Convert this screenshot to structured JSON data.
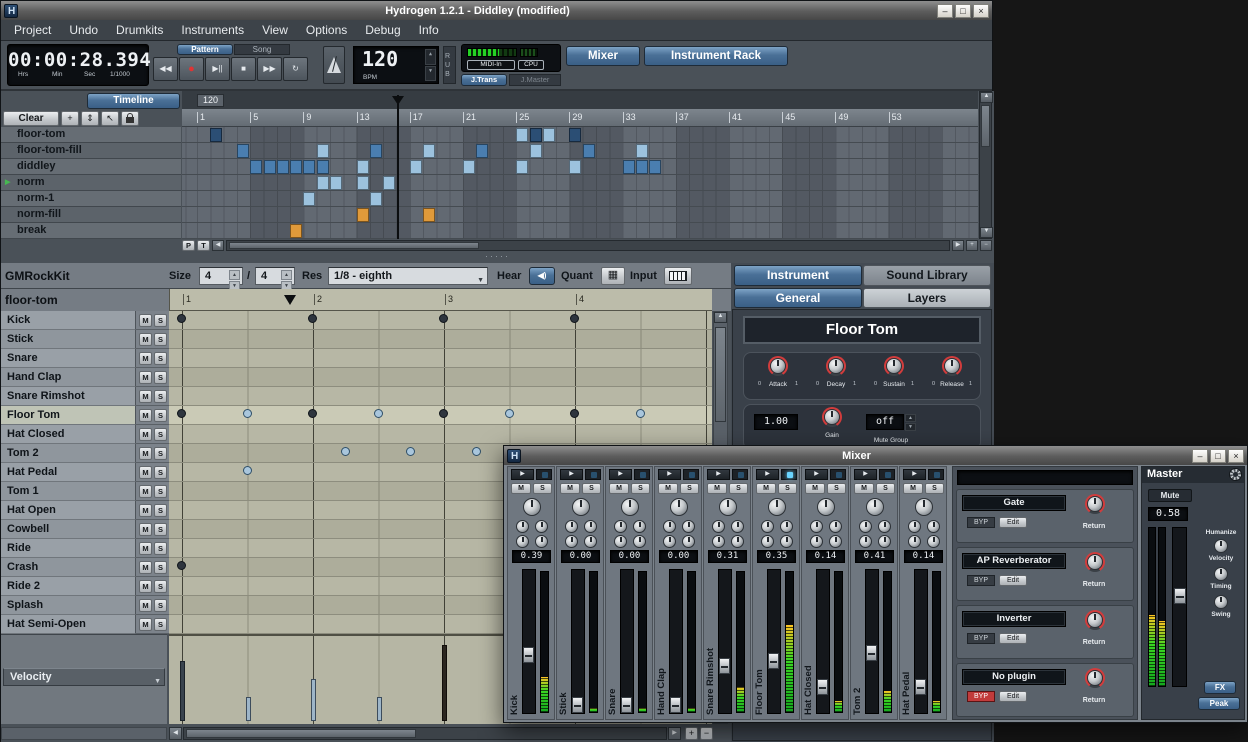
{
  "main_window": {
    "title": "Hydrogen 1.2.1 - Diddley (modified)"
  },
  "icons": {
    "minimize": "–",
    "maximize": "□",
    "close": "×",
    "rewind": "◀◀",
    "record": "●",
    "play_pause": "▶||",
    "stop": "■",
    "forward": "▶▶",
    "loop": "↻",
    "spin_up": "▲",
    "spin_down": "▼",
    "dropdown": "▼",
    "scroll_left": "◀",
    "scroll_right": "▶",
    "scroll_up": "▲",
    "scroll_down": "▼",
    "plus": "+",
    "minus": "−",
    "updown": "⇕",
    "select": "↖",
    "speaker": "◀)",
    "grid": "▦",
    "play_small": "▶"
  },
  "menu": {
    "items": [
      "Project",
      "Undo",
      "Drumkits",
      "Instruments",
      "View",
      "Options",
      "Debug",
      "Info"
    ]
  },
  "transport": {
    "time_value": "00:00:28.394",
    "time_units": [
      "Hrs",
      "Min",
      "Sec",
      "1/1000"
    ],
    "mode_pattern": "Pattern",
    "mode_song": "Song",
    "bpm_value": "120",
    "bpm_label": "BPM",
    "rubberband": "RUB",
    "midi_label": "MIDI-In",
    "cpu_label": "CPU",
    "jack_transport": "J.Trans",
    "jack_master": "J.Master",
    "mixer_button": "Mixer",
    "rack_button": "Instrument Rack"
  },
  "song_editor": {
    "timeline_button": "Timeline",
    "clear_button": "Clear",
    "tempo_tag": "120",
    "ruler_ticks": [
      1,
      5,
      9,
      13,
      17,
      21,
      25,
      29,
      33,
      37,
      41,
      45,
      49,
      53
    ],
    "playhead_col": 16,
    "patterns": [
      "floor-tom",
      "floor-tom-fill",
      "diddley",
      "norm",
      "norm-1",
      "norm-fill",
      "break"
    ],
    "playing_pattern_index": 3,
    "button_p": "P",
    "button_t": "T",
    "cell_colors": {
      "mid": "#4a7eb0",
      "light": "#9cc2de",
      "dark": "#2b4e74",
      "orange": "#e09a3a"
    },
    "cells": [
      {
        "row": 0,
        "col": 2,
        "color": "dark"
      },
      {
        "row": 0,
        "col": 25,
        "color": "light"
      },
      {
        "row": 0,
        "col": 26,
        "color": "dark"
      },
      {
        "row": 0,
        "col": 27,
        "color": "light"
      },
      {
        "row": 0,
        "col": 29,
        "color": "dark"
      },
      {
        "row": 1,
        "col": 4,
        "color": "mid"
      },
      {
        "row": 1,
        "col": 10,
        "color": "light"
      },
      {
        "row": 1,
        "col": 14,
        "color": "mid"
      },
      {
        "row": 1,
        "col": 18,
        "color": "light"
      },
      {
        "row": 1,
        "col": 22,
        "color": "mid"
      },
      {
        "row": 1,
        "col": 26,
        "color": "light"
      },
      {
        "row": 1,
        "col": 30,
        "color": "mid"
      },
      {
        "row": 1,
        "col": 34,
        "color": "light"
      },
      {
        "row": 2,
        "col": 5,
        "color": "mid"
      },
      {
        "row": 2,
        "col": 6,
        "color": "mid"
      },
      {
        "row": 2,
        "col": 7,
        "color": "mid"
      },
      {
        "row": 2,
        "col": 8,
        "color": "mid"
      },
      {
        "row": 2,
        "col": 9,
        "color": "mid"
      },
      {
        "row": 2,
        "col": 10,
        "color": "mid"
      },
      {
        "row": 2,
        "col": 13,
        "color": "light"
      },
      {
        "row": 2,
        "col": 17,
        "color": "light"
      },
      {
        "row": 2,
        "col": 21,
        "color": "light"
      },
      {
        "row": 2,
        "col": 25,
        "color": "light"
      },
      {
        "row": 2,
        "col": 29,
        "color": "light"
      },
      {
        "row": 2,
        "col": 33,
        "color": "mid"
      },
      {
        "row": 2,
        "col": 34,
        "color": "mid"
      },
      {
        "row": 2,
        "col": 35,
        "color": "mid"
      },
      {
        "row": 3,
        "col": 10,
        "color": "light"
      },
      {
        "row": 3,
        "col": 11,
        "color": "light"
      },
      {
        "row": 3,
        "col": 13,
        "color": "light"
      },
      {
        "row": 3,
        "col": 15,
        "color": "light"
      },
      {
        "row": 4,
        "col": 9,
        "color": "light"
      },
      {
        "row": 4,
        "col": 14,
        "color": "light"
      },
      {
        "row": 5,
        "col": 13,
        "color": "orange"
      },
      {
        "row": 5,
        "col": 18,
        "color": "orange"
      },
      {
        "row": 6,
        "col": 8,
        "color": "orange"
      }
    ]
  },
  "pattern_editor": {
    "drumkit_name": "GMRockKit",
    "pattern_name": "floor-tom",
    "size_label": "Size",
    "size_numerator": "4",
    "size_separator": "/",
    "size_denominator": "4",
    "res_label": "Res",
    "res_value": "1/8 - eighth",
    "hear_label": "Hear",
    "quant_label": "Quant",
    "input_label": "Input",
    "beat_numbers": [
      "1",
      "2",
      "3",
      "4"
    ],
    "mute_label": "M",
    "solo_label": "S",
    "instruments": [
      "Kick",
      "Stick",
      "Snare",
      "Hand Clap",
      "Snare Rimshot",
      "Floor Tom",
      "Hat Closed",
      "Tom 2",
      "Hat Pedal",
      "Tom 1",
      "Hat Open",
      "Cowbell",
      "Ride",
      "Crash",
      "Ride 2",
      "Splash",
      "Hat Semi-Open"
    ],
    "selected_instrument_index": 5,
    "notes": [
      {
        "row": 0,
        "beat": 1,
        "type": "filled"
      },
      {
        "row": 0,
        "beat": 2,
        "type": "filled"
      },
      {
        "row": 0,
        "beat": 3,
        "type": "filled"
      },
      {
        "row": 0,
        "beat": 4,
        "type": "filled"
      },
      {
        "row": 5,
        "beat": 1,
        "type": "filled"
      },
      {
        "row": 5,
        "beat": 1.5,
        "type": "hollow"
      },
      {
        "row": 5,
        "beat": 2,
        "type": "filled"
      },
      {
        "row": 5,
        "beat": 2.5,
        "type": "hollow"
      },
      {
        "row": 5,
        "beat": 3,
        "type": "filled"
      },
      {
        "row": 5,
        "beat": 3.5,
        "type": "hollow"
      },
      {
        "row": 5,
        "beat": 4,
        "type": "filled"
      },
      {
        "row": 5,
        "beat": 4.5,
        "type": "hollow"
      },
      {
        "row": 7,
        "beat": 2.25,
        "type": "hollow"
      },
      {
        "row": 7,
        "beat": 2.75,
        "type": "hollow"
      },
      {
        "row": 7,
        "beat": 3.25,
        "type": "hollow"
      },
      {
        "row": 8,
        "beat": 1.5,
        "type": "hollow"
      },
      {
        "row": 13,
        "beat": 1,
        "type": "filled"
      }
    ],
    "velocity_selector": "Velocity",
    "velocity_bars": [
      {
        "beat": 1,
        "height": 0.72,
        "style": "dark"
      },
      {
        "beat": 1.5,
        "height": 0.28,
        "style": "light"
      },
      {
        "beat": 2,
        "height": 0.5,
        "style": "light"
      },
      {
        "beat": 2.5,
        "height": 0.28,
        "style": "light"
      },
      {
        "beat": 3,
        "height": 0.9,
        "style": "darker"
      }
    ]
  },
  "instrument_rack": {
    "tab_instrument": "Instrument",
    "tab_sound_library": "Sound Library",
    "tab_general": "General",
    "tab_layers": "Layers",
    "instrument_name": "Floor Tom",
    "knob_min": "0",
    "knob_max": "1",
    "envelope_knobs": [
      "Attack",
      "Decay",
      "Sustain",
      "Release"
    ],
    "gain_value": "1.00",
    "gain_label": "Gain",
    "mute_group_value": "off",
    "mute_group_label": "Mute Group"
  },
  "mixer": {
    "title": "Mixer",
    "mute_label": "M",
    "solo_label": "S",
    "channels": [
      {
        "name": "Kick",
        "value": "0.39",
        "fader": 0.39,
        "meter": 0.25,
        "led": false
      },
      {
        "name": "Stick",
        "value": "0.00",
        "fader": 0.0,
        "meter": 0.03,
        "led": false
      },
      {
        "name": "Snare",
        "value": "0.00",
        "fader": 0.0,
        "meter": 0.03,
        "led": false
      },
      {
        "name": "Hand Clap",
        "value": "0.00",
        "fader": 0.0,
        "meter": 0.03,
        "led": false
      },
      {
        "name": "Snare Rimshot",
        "value": "0.31",
        "fader": 0.31,
        "meter": 0.18,
        "led": false
      },
      {
        "name": "Floor Tom",
        "value": "0.35",
        "fader": 0.35,
        "meter": 0.62,
        "led": true
      },
      {
        "name": "Hat Closed",
        "value": "0.14",
        "fader": 0.14,
        "meter": 0.08,
        "led": false
      },
      {
        "name": "Tom 2",
        "value": "0.41",
        "fader": 0.41,
        "meter": 0.15,
        "led": false
      },
      {
        "name": "Hat Pedal",
        "value": "0.14",
        "fader": 0.14,
        "meter": 0.08,
        "led": false
      }
    ],
    "fx_byp_label": "BYP",
    "fx_edit_label": "Edit",
    "fx_return_label": "Return",
    "fx_display_value": "",
    "fx_units": [
      {
        "name": "Gate",
        "bypass_active": false
      },
      {
        "name": "AP Reverberator",
        "bypass_active": false
      },
      {
        "name": "Inverter",
        "bypass_active": false
      },
      {
        "name": "No plugin",
        "bypass_active": true
      }
    ],
    "master": {
      "label": "Master",
      "mute_label": "Mute",
      "value": "0.58",
      "fader": 0.58,
      "meter": 0.45,
      "humanize_label": "Humanize",
      "knob_labels": [
        "Velocity",
        "Timing",
        "Swing"
      ],
      "fx_button": "FX",
      "peak_button": "Peak"
    }
  }
}
